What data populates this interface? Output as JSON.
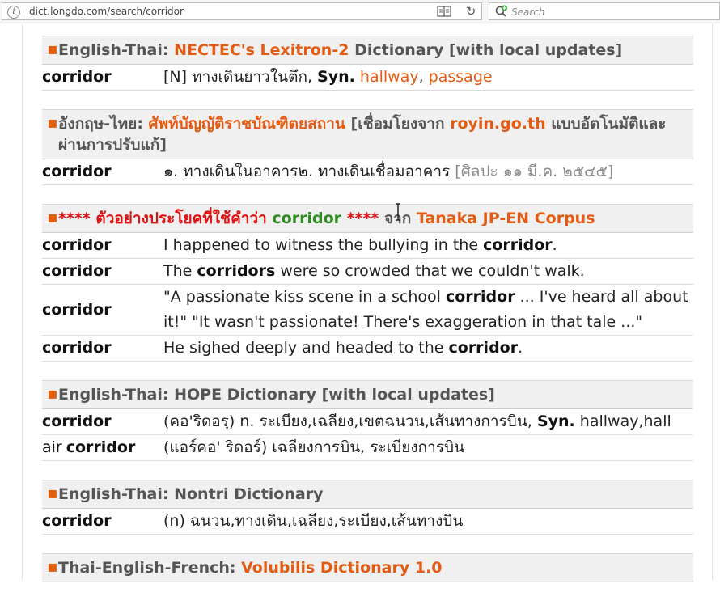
{
  "browser": {
    "url": "dict.longdo.com/search/corridor",
    "search_placeholder": "Search"
  },
  "colors": {
    "accent_orange": "#e35b12",
    "red": "#dd1111",
    "green": "#2e8b22"
  },
  "sections": {
    "lexitron": {
      "prefix": "English-Thai: ",
      "source": "NECTEC's Lexitron-2",
      "suffix": " Dictionary [with local updates]",
      "row": {
        "word": "corridor",
        "pos": "[N] ทางเดินยาวในตึก, ",
        "syn": "Syn.",
        "syn1": "hallway",
        "sep": ", ",
        "syn2": "passage"
      }
    },
    "royin": {
      "prefix": "อังกฤษ-ไทย: ",
      "source": "ศัพท์บัญญัติราชบัณฑิตยสถาน",
      "mid": " [เชื่อมโยงจาก ",
      "link": "royin.go.th",
      "suffix": " แบบอัตโนมัติและผ่านการปรับแก้]",
      "row": {
        "word": "corridor",
        "def": "๑. ทางเดินในอาคาร๒. ทางเดินเชื่อมอาคาร ",
        "ref": "[ศิลปะ ๑๑ มี.ค. ๒๕๔๕]"
      }
    },
    "tanaka": {
      "prefix": "**** ตัวอย่างประโยคที่ใช้คำว่า ",
      "keyword": "corridor",
      "mid": " ****",
      "from": " จาก ",
      "source": "Tanaka JP-EN Corpus",
      "rows": [
        {
          "word": "corridor",
          "a": "I happened to witness the bullying in the ",
          "b": "corridor",
          "c": "."
        },
        {
          "word": "corridor",
          "a": "The ",
          "b": "corridors",
          "c": " were so crowded that we couldn't walk."
        },
        {
          "word": "corridor",
          "a": "\"A passionate kiss scene in a school ",
          "b": "corridor",
          "c": " ... I've heard all about it!\" \"It wasn't passionate! There's exaggeration in that tale ...\""
        },
        {
          "word": "corridor",
          "a": "He sighed deeply and headed to the ",
          "b": "corridor",
          "c": "."
        }
      ]
    },
    "hope": {
      "title": "English-Thai: HOPE Dictionary [with local updates]",
      "rows": [
        {
          "word": "corridor",
          "pre": "",
          "a": "(คอ'ริดอรฺ) n. ระเบียง,เฉลียง,เขตฉนวน,เส้นทางการบิน, ",
          "syn": "Syn.",
          "c": " hallway,hall"
        },
        {
          "word": "corridor",
          "pre": "air",
          "a": "(แอร์คอ' ริดอร์) เฉลียงการบิน, ระเบียงการบิน",
          "syn": "",
          "c": ""
        }
      ]
    },
    "nontri": {
      "title": "English-Thai: Nontri Dictionary",
      "row": {
        "word": "corridor",
        "def": "(n) ฉนวน,ทางเดิน,เฉลียง,ระเบียง,เส้นทางบิน"
      }
    },
    "volubilis": {
      "prefix": "Thai-English-French: ",
      "source": "Volubilis Dictionary 1.0"
    }
  }
}
